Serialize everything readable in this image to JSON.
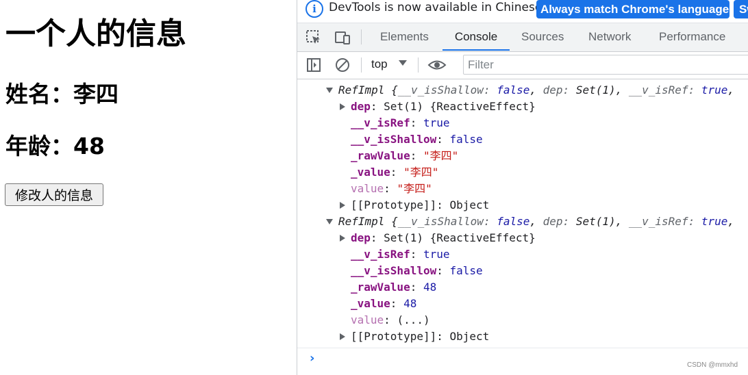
{
  "page": {
    "heading": "一个人的信息",
    "name_line": "姓名：李四",
    "age_line": "年龄：48",
    "edit_button": "修改人的信息"
  },
  "devtools": {
    "infobar": {
      "text": "DevTools is now available in Chinese!",
      "match_button": "Always match Chrome's language",
      "switch_button": "Switch DevTools to Chinese"
    },
    "tabs": [
      "Elements",
      "Console",
      "Sources",
      "Network",
      "Performance"
    ],
    "active_tab": "Console",
    "toolbar": {
      "context": "top",
      "filter_placeholder": "Filter"
    },
    "icons": {
      "inspect": "inspect-element-icon",
      "device": "device-toolbar-icon",
      "sidebar": "console-sidebar-icon",
      "clear": "clear-console-icon",
      "eye": "live-expression-icon"
    },
    "console": {
      "entry1": {
        "header_name": "RefImpl",
        "header_rest_open": " {",
        "h_k1": "__v_isShallow",
        "h_v1": "false",
        "h_k2": "dep",
        "h_v2": "Set(1)",
        "h_k3": "__v_isRef",
        "h_v3": "true",
        "dep_key": "dep",
        "dep_val": "Set(1) {ReactiveEffect}",
        "isref_key": "__v_isRef",
        "isref_val": "true",
        "isshallow_key": "__v_isShallow",
        "isshallow_val": "false",
        "raw_key": "_rawValue",
        "raw_val": "\"李四\"",
        "val_key": "_value",
        "val_val": "\"李四\"",
        "value_key": "value",
        "value_val": "\"李四\"",
        "proto_key": "[[Prototype]]",
        "proto_val": "Object"
      },
      "entry2": {
        "header_name": "RefImpl",
        "header_rest_open": " {",
        "h_k1": "__v_isShallow",
        "h_v1": "false",
        "h_k2": "dep",
        "h_v2": "Set(1)",
        "h_k3": "__v_isRef",
        "h_v3": "true",
        "dep_key": "dep",
        "dep_val": "Set(1) {ReactiveEffect}",
        "isref_key": "__v_isRef",
        "isref_val": "true",
        "isshallow_key": "__v_isShallow",
        "isshallow_val": "false",
        "raw_key": "_rawValue",
        "raw_val": "48",
        "val_key": "_value",
        "val_val": "48",
        "value_key": "value",
        "value_val": "(...)",
        "proto_key": "[[Prototype]]",
        "proto_val": "Object"
      }
    },
    "watermark": "CSDN @mmxhd"
  },
  "colors": {
    "accent": "#1a73e8",
    "key": "#881280",
    "string": "#c41a16",
    "number": "#1a1aa6"
  }
}
